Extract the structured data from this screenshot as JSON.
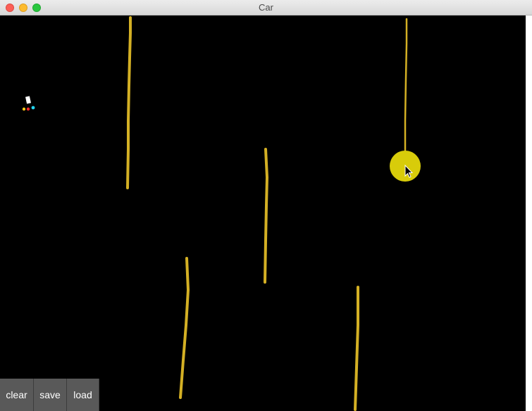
{
  "window": {
    "title": "Car",
    "controls": [
      "close",
      "minimize",
      "zoom"
    ]
  },
  "canvas": {
    "background_color": "#000000",
    "line_color": "#d4b024",
    "cursor_highlight_color": "#d8cc0a",
    "car_colors": {
      "body": "#ffffff",
      "sensor_left": "#f5c518",
      "sensor_center": "#ff2a2a",
      "sensor_right": "#22d3f0"
    }
  },
  "toolbar": {
    "clear_label": "clear",
    "save_label": "save",
    "load_label": "load"
  }
}
